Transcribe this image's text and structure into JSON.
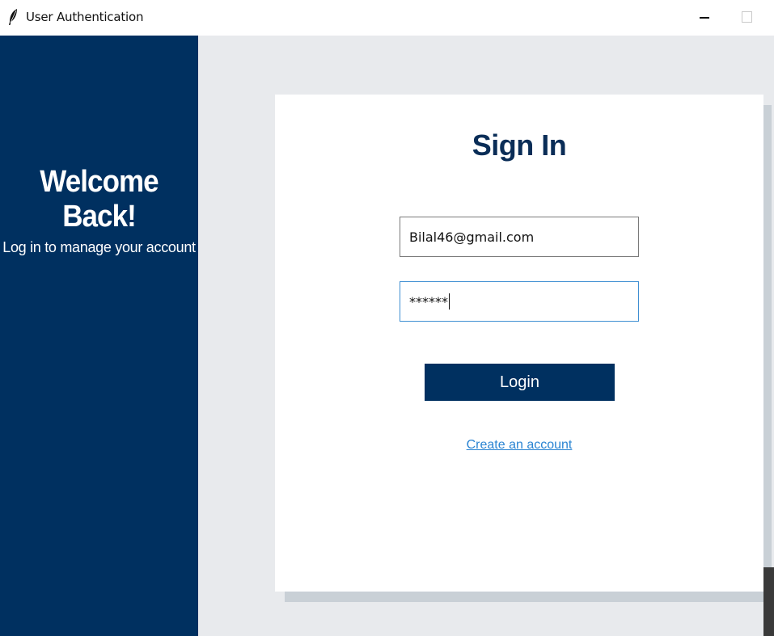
{
  "window": {
    "title": "User Authentication",
    "icon": "feather-icon"
  },
  "sidebar": {
    "title": "Welcome Back!",
    "subtitle": "Log in to manage your account",
    "background": "#003060"
  },
  "form": {
    "title": "Sign In",
    "email_value": "Bilal46@gmail.com",
    "password_value": "******",
    "login_label": "Login",
    "create_account_label": "Create an account"
  },
  "colors": {
    "primary": "#003060",
    "link": "#2a84d2",
    "focus_border": "#3f8fd2",
    "page_background": "#e8eaed"
  }
}
